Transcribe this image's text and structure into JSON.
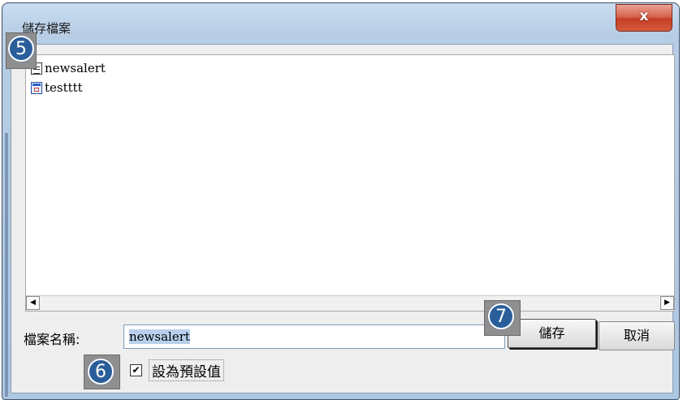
{
  "dialog": {
    "title": "儲存檔案",
    "close_label": "x"
  },
  "file_list": {
    "items": [
      {
        "name": "newsalert",
        "icon": "document-icon"
      },
      {
        "name": "testttt",
        "icon": "application-icon"
      }
    ],
    "scroll_left": "◀",
    "scroll_right": "▶"
  },
  "filename": {
    "label": "檔案名稱:",
    "value": "newsalert"
  },
  "buttons": {
    "save": "儲存",
    "cancel": "取消"
  },
  "default_option": {
    "checked": true,
    "check_mark": "✔",
    "label": "設為預設值"
  },
  "callouts": {
    "five": "5",
    "six": "6",
    "seven": "7"
  },
  "colors": {
    "badge": "#2a5e9a",
    "badge_bg": "#8f8f8f",
    "close_button": "#c43e26"
  }
}
